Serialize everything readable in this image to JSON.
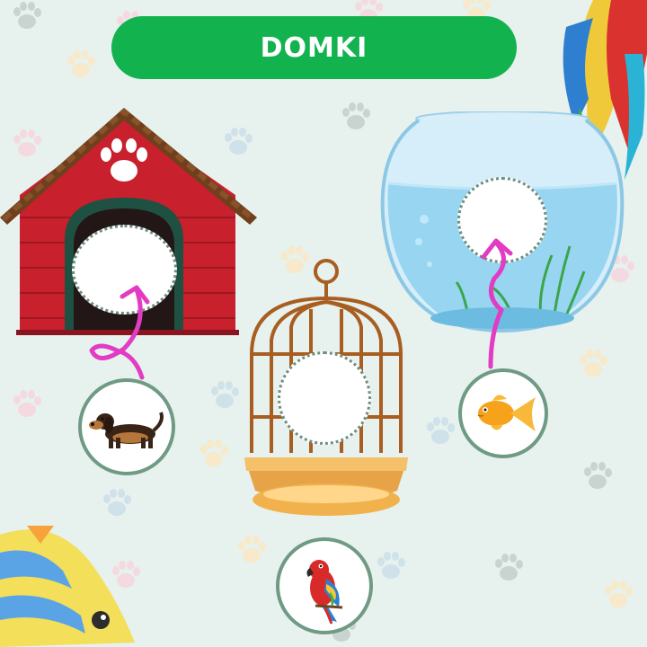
{
  "title": "DOMKI",
  "colors": {
    "background": "#e7f1ed",
    "banner": "#12b24f",
    "arrow": "#e23bc4",
    "slot_border": "#6f8f80",
    "token_border": "#6f9a84"
  },
  "homes": [
    {
      "name": "doghouse",
      "icon": "doghouse-icon"
    },
    {
      "name": "birdcage",
      "icon": "birdcage-icon"
    },
    {
      "name": "fishbowl",
      "icon": "fishbowl-icon"
    }
  ],
  "animals": [
    {
      "name": "dog",
      "icon": "dachshund-icon",
      "target": "doghouse"
    },
    {
      "name": "parrot",
      "icon": "parrot-icon",
      "target": "birdcage"
    },
    {
      "name": "goldfish",
      "icon": "goldfish-icon",
      "target": "fishbowl"
    }
  ]
}
